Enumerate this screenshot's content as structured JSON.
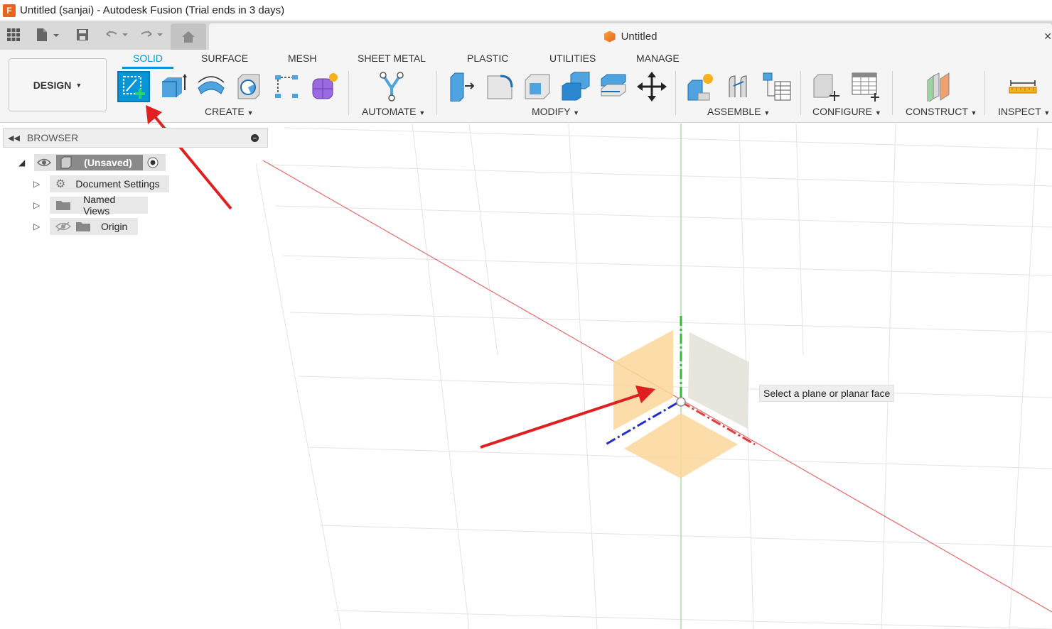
{
  "window": {
    "title": "Untitled (sanjai) - Autodesk Fusion (Trial ends in 3 days)",
    "logo_letter": "F"
  },
  "document_tab": {
    "title": "Untitled"
  },
  "workspace": {
    "label": "DESIGN"
  },
  "ribbon_tabs": [
    "SOLID",
    "SURFACE",
    "MESH",
    "SHEET METAL",
    "PLASTIC",
    "UTILITIES",
    "MANAGE"
  ],
  "groups": {
    "create": "CREATE",
    "automate": "AUTOMATE",
    "modify": "MODIFY",
    "assemble": "ASSEMBLE",
    "configure": "CONFIGURE",
    "construct": "CONSTRUCT",
    "inspect": "INSPECT"
  },
  "browser": {
    "title": "BROWSER",
    "root": "(Unsaved)",
    "items": [
      "Document Settings",
      "Named Views",
      "Origin"
    ]
  },
  "viewport": {
    "prompt": "Select a plane or planar face"
  },
  "colors": {
    "accent": "#0696d7",
    "plane": "#fcd79a",
    "x_axis": "#e03c3c",
    "y_axis": "#2dbf2d",
    "z_axis": "#2030c8",
    "annotation": "#e02020"
  }
}
